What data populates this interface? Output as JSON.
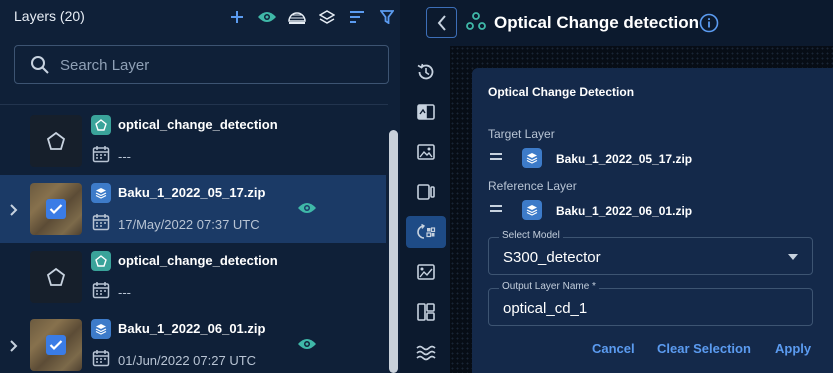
{
  "layers_panel": {
    "title": "Layers (20)",
    "tools": [
      "add-icon",
      "eye-icon",
      "layer-compare-icon",
      "layers-stack-icon",
      "sort-icon",
      "filter-icon"
    ],
    "search": {
      "placeholder": "Search Layer",
      "value": ""
    },
    "rows": [
      {
        "name": "optical_change_detection",
        "date": "---",
        "type": "vector",
        "selected": false,
        "thumbnail": "polygon"
      },
      {
        "name": "Baku_1_2022_05_17.zip",
        "date": "17/May/2022 07:37 UTC",
        "type": "raster",
        "selected": true,
        "checked": true,
        "visible": true,
        "thumbnail": "satellite"
      },
      {
        "name": "optical_change_detection",
        "date": "---",
        "type": "vector",
        "selected": false,
        "thumbnail": "polygon"
      },
      {
        "name": "Baku_1_2022_06_01.zip",
        "date": "01/Jun/2022 07:27 UTC",
        "type": "raster",
        "selected": false,
        "checked": true,
        "visible": true,
        "thumbnail": "satellite"
      }
    ]
  },
  "topbar": {
    "title": "Optical Change detection"
  },
  "side_toolbar": {
    "items": [
      "history-icon",
      "compare-icon",
      "image-icon",
      "split-view-icon",
      "change-detection-icon",
      "image-settings-icon",
      "layout-icon",
      "waves-icon"
    ],
    "active": "change-detection-icon"
  },
  "dialog": {
    "title": "Optical Change Detection",
    "target_label": "Target Layer",
    "target_layer": "Baku_1_2022_05_17.zip",
    "reference_label": "Reference Layer",
    "reference_layer": "Baku_1_2022_06_01.zip",
    "model_label": "Select Model",
    "model_value": "S300_detector",
    "output_label": "Output Layer Name *",
    "output_value": "optical_cd_1",
    "cancel": "Cancel",
    "clear": "Clear Selection",
    "apply": "Apply"
  },
  "colors": {
    "accent": "#5b9bf0",
    "panel": "#0f2038",
    "selected_row": "#1b3a66",
    "eye": "#3fb8a8"
  }
}
